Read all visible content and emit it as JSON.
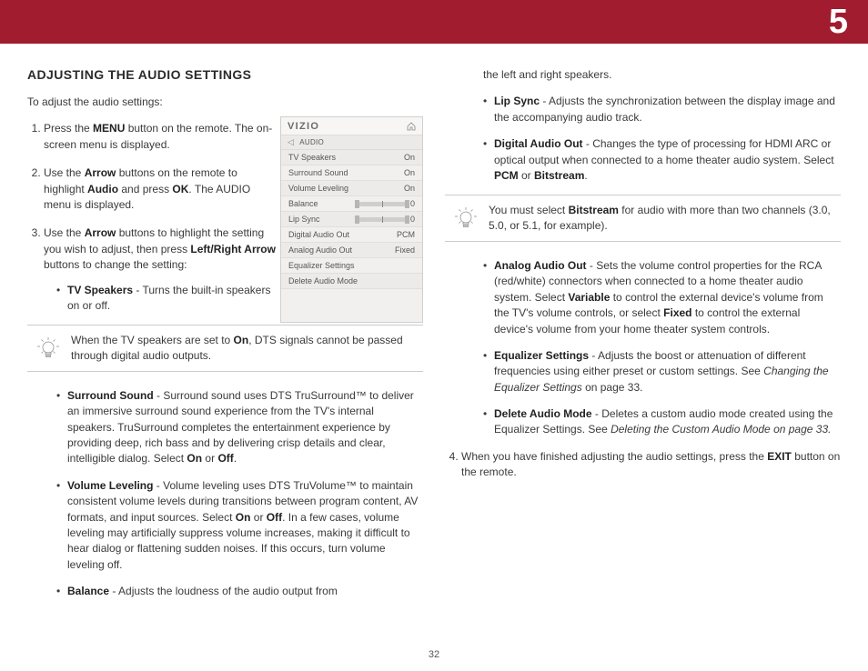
{
  "chapter": "5",
  "pageNumber": "32",
  "title": "ADJUSTING THE AUDIO SETTINGS",
  "intro": "To adjust the audio settings:",
  "steps": {
    "s1a": "Press the ",
    "s1b": "MENU",
    "s1c": " button on the remote. The on-screen menu is displayed.",
    "s2a": "Use the ",
    "s2b": "Arrow",
    "s2c": " buttons on the remote to highlight ",
    "s2d": "Audio",
    "s2e": " and press ",
    "s2f": "OK",
    "s2g": ". The AUDIO menu is displayed.",
    "s3a": "Use the ",
    "s3b": "Arrow",
    "s3c": " buttons to highlight the setting you wish to adjust, then press ",
    "s3d": "Left/Right Arrow",
    "s3e": " buttons to change the setting:"
  },
  "bullets_left": {
    "b1_label": "TV Speakers",
    "b1_text": " - Turns the built-in speakers on or off.",
    "b2_label": "Surround Sound",
    "b2_text_a": " - Surround sound uses DTS TruSurround™ to deliver an immersive surround sound experience from the TV's internal speakers. TruSurround completes the entertainment experience by providing deep, rich bass and by delivering crisp details and clear, intelligible dialog. Select ",
    "b2_on": "On",
    "b2_or": " or ",
    "b2_off": "Off",
    "b2_period": ".",
    "b3_label": "Volume Leveling",
    "b3_text_a": " - Volume leveling uses DTS TruVolume™ to maintain consistent volume levels during transitions between program content, AV formats, and input sources. Select ",
    "b3_on": "On",
    "b3_or": " or ",
    "b3_off": "Off",
    "b3_tail": ". In a few cases, volume leveling may artificially suppress volume increases, making it difficult to hear dialog or flattening sudden noises. If this occurs, turn volume leveling off.",
    "b4_label": "Balance",
    "b4_text": " - Adjusts the loudness of the audio output from"
  },
  "note_left_a": "When the TV speakers are set to ",
  "note_left_b": "On",
  "note_left_c": ", DTS signals cannot be passed through digital audio outputs.",
  "right_cont": "the left and right speakers.",
  "bullets_right": {
    "r1_label": "Lip Sync",
    "r1_text": " - Adjusts the synchronization between the display image and the accompanying audio track.",
    "r2_label": "Digital Audio Out",
    "r2_text_a": " - Changes the type of processing for HDMI ARC or optical output when connected to a home theater audio system. Select ",
    "r2_pcm": "PCM",
    "r2_or": " or ",
    "r2_bit": "Bitstream",
    "r2_period": ".",
    "r3_label": "Analog Audio Out",
    "r3_text_a": " - Sets the volume control properties for the RCA (red/white) connectors when connected to a home theater audio system. Select ",
    "r3_var": "Variable",
    "r3_text_b": " to control the external device's volume from the TV's volume controls, or select ",
    "r3_fix": "Fixed",
    "r3_text_c": " to control the external device's volume from your home theater system controls.",
    "r4_label": "Equalizer Settings",
    "r4_text_a": " - Adjusts the boost or attenuation of different frequencies using either preset or custom settings. See ",
    "r4_em": "Changing the Equalizer Settings",
    "r4_text_b": " on page 33.",
    "r5_label": "Delete Audio Mode",
    "r5_text_a": " - Deletes a custom audio mode created using the Equalizer Settings. See ",
    "r5_em": "Deleting the Custom Audio Mode on page 33.",
    "step4_a": "When you have finished adjusting the audio settings, press the ",
    "step4_b": "EXIT",
    "step4_c": " button on the remote."
  },
  "note_right_a": "You must select ",
  "note_right_b": "Bitstream",
  "note_right_c": " for audio with more than two channels (3.0, 5.0, or 5.1, for example).",
  "osd": {
    "brand": "VIZIO",
    "header": "AUDIO",
    "rows": [
      {
        "label": "TV Speakers",
        "value": "On",
        "type": "text"
      },
      {
        "label": "Surround Sound",
        "value": "On",
        "type": "text"
      },
      {
        "label": "Volume Leveling",
        "value": "On",
        "type": "text"
      },
      {
        "label": "Balance",
        "value": "0",
        "type": "slider"
      },
      {
        "label": "Lip Sync",
        "value": "0",
        "type": "slider"
      },
      {
        "label": "Digital Audio Out",
        "value": "PCM",
        "type": "text"
      },
      {
        "label": "Analog Audio Out",
        "value": "Fixed",
        "type": "text"
      },
      {
        "label": "Equalizer Settings",
        "value": "",
        "type": "text"
      },
      {
        "label": "Delete Audio Mode",
        "value": "",
        "type": "text"
      }
    ]
  }
}
